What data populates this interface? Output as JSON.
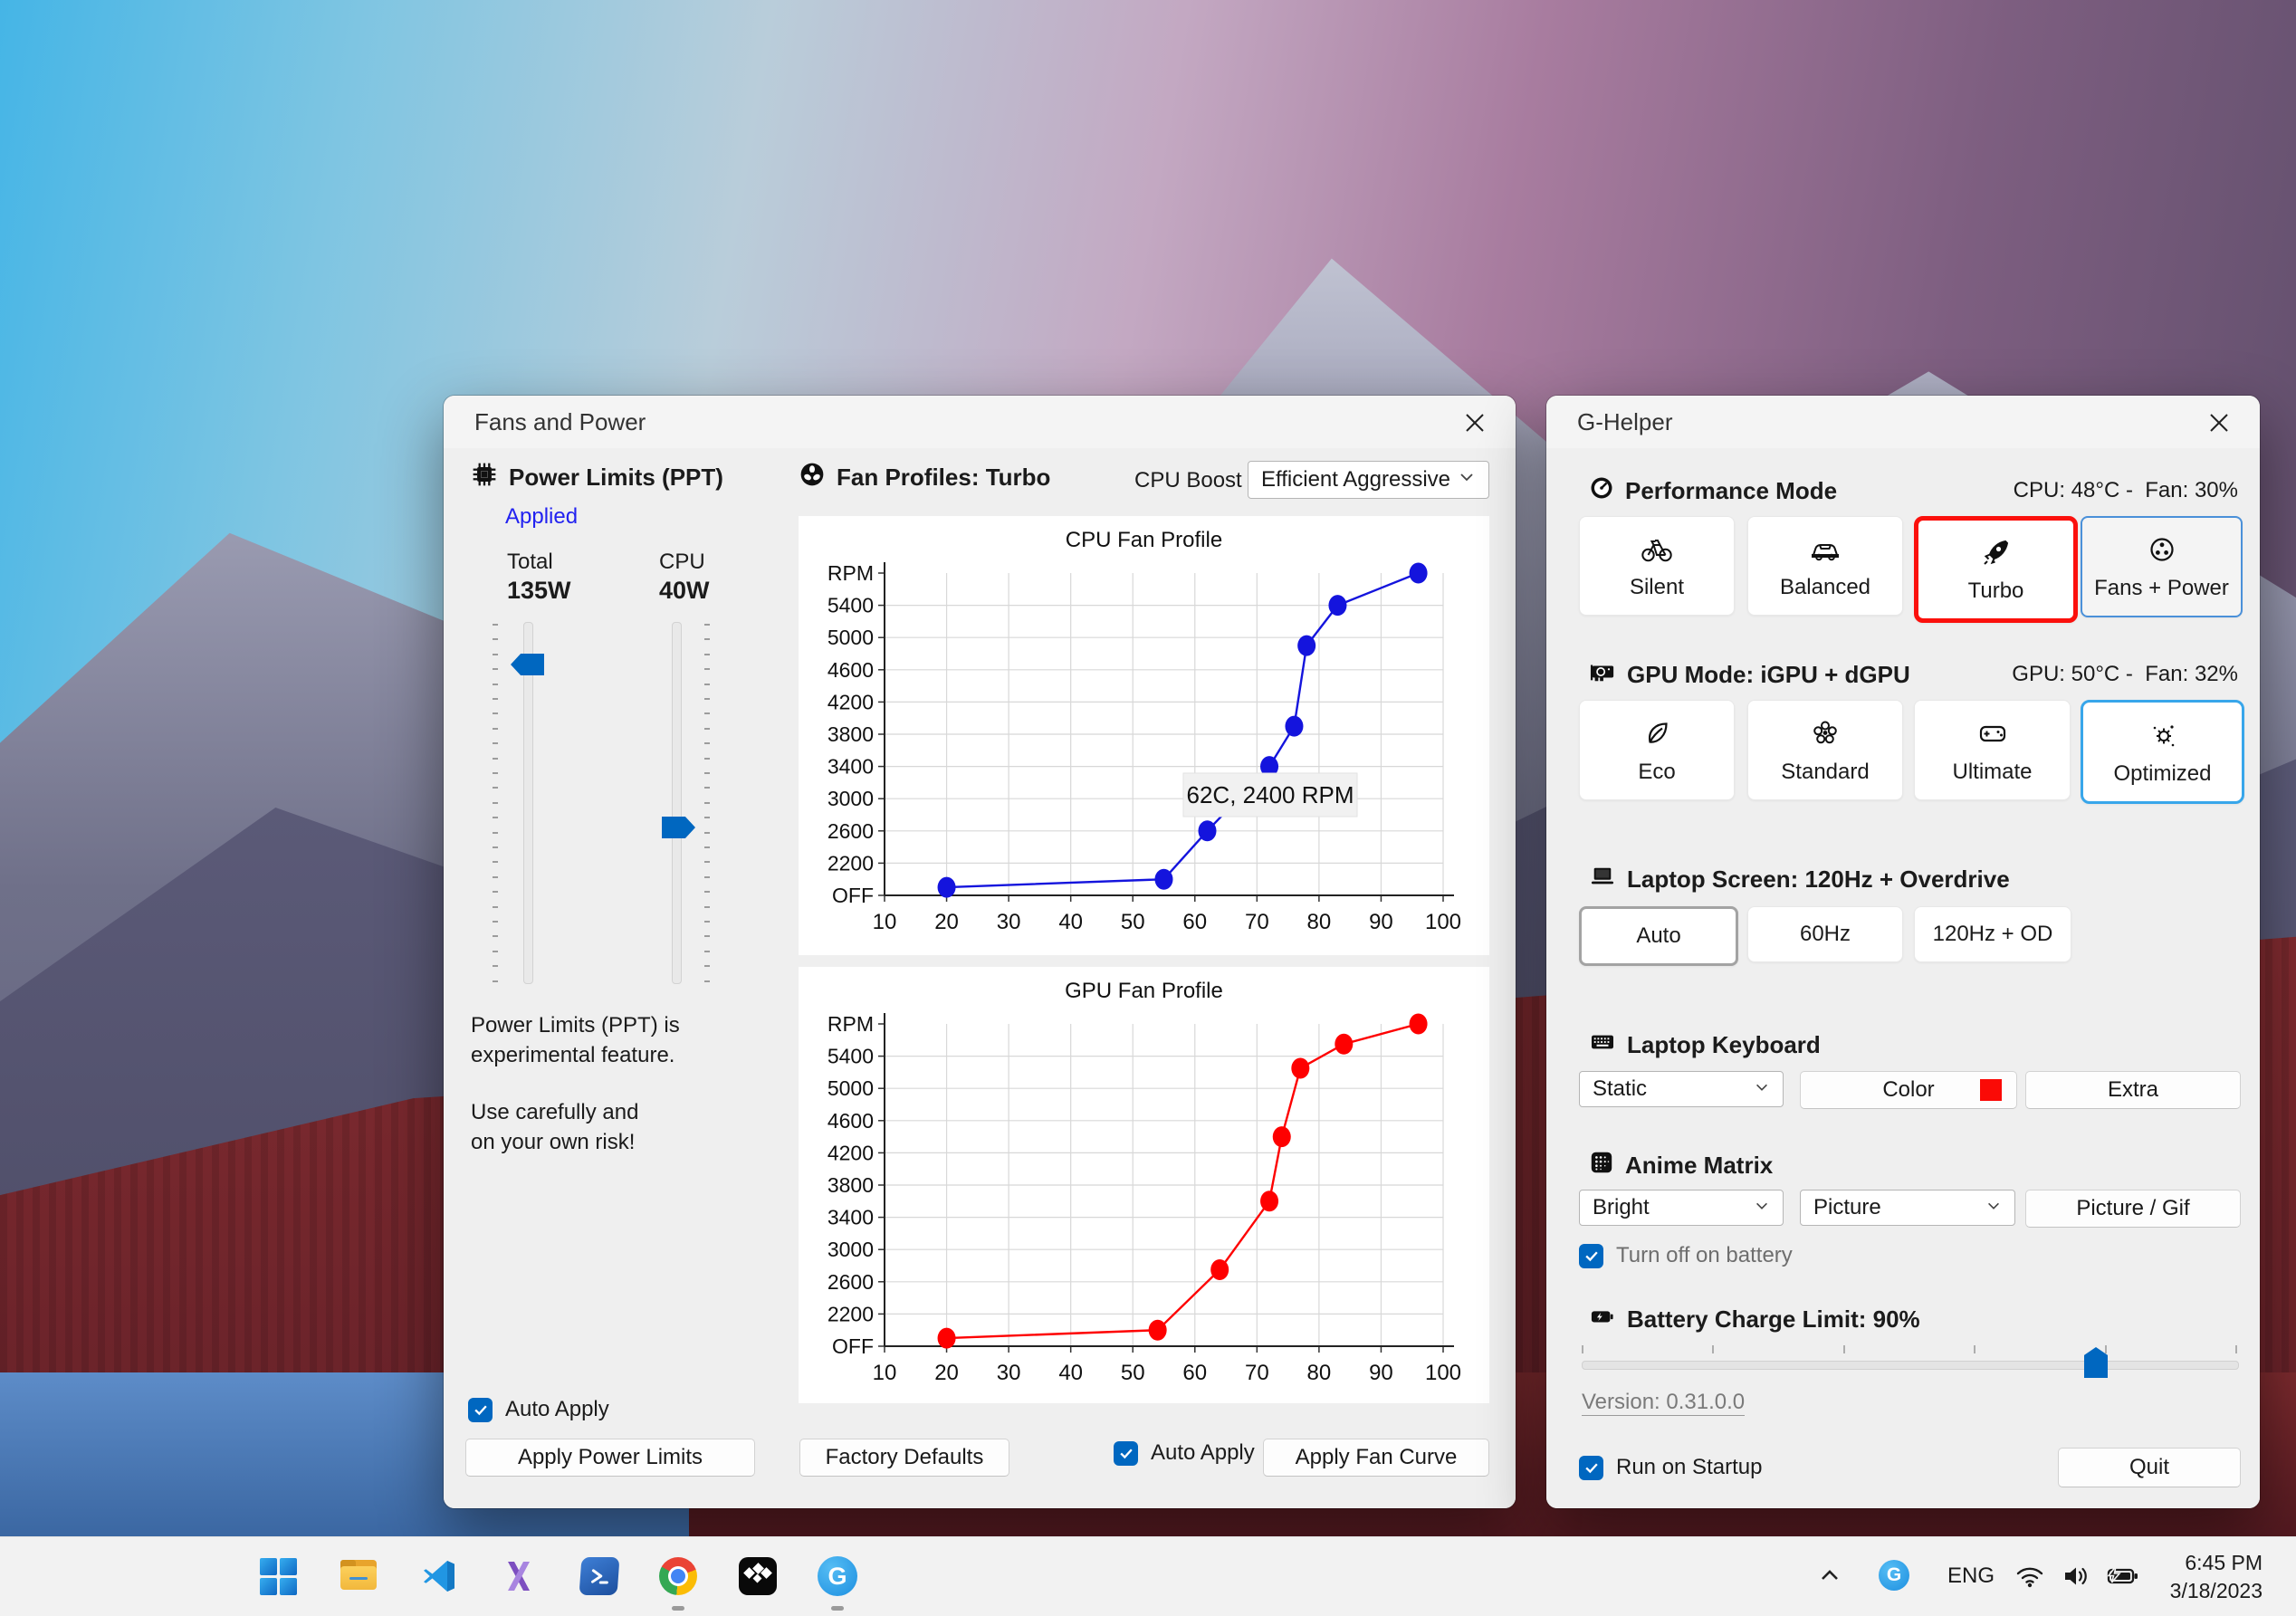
{
  "colors": {
    "accent_blue": "#0067c0",
    "selected_red": "#fb100c",
    "selected_blue": "#38a6ea",
    "keyboard_color_swatch": "#fa0a06",
    "chart_cpu_blue": "#1414dd",
    "chart_gpu_red": "#fe0000"
  },
  "fans_window": {
    "title": "Fans and Power",
    "power_limits": {
      "header": "Power Limits (PPT)",
      "applied": "Applied",
      "total_label": "Total",
      "total_value": "135W",
      "cpu_label": "CPU",
      "cpu_value": "40W",
      "warning_line1": "Power Limits (PPT) is",
      "warning_line2": "experimental feature.",
      "warning_line3": "Use carefully and",
      "warning_line4": "on your own risk!",
      "auto_apply_label": "Auto Apply",
      "apply_button": "Apply Power Limits"
    },
    "fan_profiles": {
      "header": "Fan Profiles: Turbo",
      "cpu_boost_label": "CPU Boost",
      "cpu_boost_value": "Efficient Aggressive",
      "factory_defaults_button": "Factory Defaults",
      "auto_apply_label": "Auto Apply",
      "apply_button": "Apply Fan Curve"
    }
  },
  "chart_data": [
    {
      "id": "cpu-fan-profile",
      "type": "line",
      "title": "CPU Fan Profile",
      "color": "#1414dd",
      "xlim": [
        10,
        100
      ],
      "ylim_rpm": [
        1800,
        5800
      ],
      "x_ticks": [
        10,
        20,
        30,
        40,
        50,
        60,
        70,
        80,
        90,
        100
      ],
      "y_tick_labels": [
        "RPM",
        "5400",
        "5000",
        "4600",
        "4200",
        "3800",
        "3400",
        "3000",
        "2600",
        "2200",
        "OFF"
      ],
      "grid": true,
      "points": [
        {
          "x": 20,
          "rpm": 1900
        },
        {
          "x": 55,
          "rpm": 2000
        },
        {
          "x": 62,
          "rpm": 2600
        },
        {
          "x": 72,
          "rpm": 3400
        },
        {
          "x": 76,
          "rpm": 3900
        },
        {
          "x": 78,
          "rpm": 4900
        },
        {
          "x": 83,
          "rpm": 5400
        },
        {
          "x": 96,
          "rpm": 5800
        }
      ],
      "tooltip": {
        "text": "62C, 2400 RPM"
      }
    },
    {
      "id": "gpu-fan-profile",
      "type": "line",
      "title": "GPU Fan Profile",
      "color": "#fe0000",
      "xlim": [
        10,
        100
      ],
      "ylim_rpm": [
        1800,
        5800
      ],
      "x_ticks": [
        10,
        20,
        30,
        40,
        50,
        60,
        70,
        80,
        90,
        100
      ],
      "y_tick_labels": [
        "RPM",
        "5400",
        "5000",
        "4600",
        "4200",
        "3800",
        "3400",
        "3000",
        "2600",
        "2200",
        "OFF"
      ],
      "grid": true,
      "points": [
        {
          "x": 20,
          "rpm": 1900
        },
        {
          "x": 54,
          "rpm": 2000
        },
        {
          "x": 64,
          "rpm": 2750
        },
        {
          "x": 72,
          "rpm": 3600
        },
        {
          "x": 74,
          "rpm": 4400
        },
        {
          "x": 77,
          "rpm": 5250
        },
        {
          "x": 84,
          "rpm": 5550
        },
        {
          "x": 96,
          "rpm": 5800
        }
      ]
    }
  ],
  "ghelper": {
    "title": "G-Helper",
    "performance": {
      "header": "Performance Mode",
      "status": "CPU: 48°C -  Fan: 30%",
      "buttons": [
        {
          "label": "Silent"
        },
        {
          "label": "Balanced"
        },
        {
          "label": "Turbo"
        },
        {
          "label": "Fans + Power"
        }
      ]
    },
    "gpu": {
      "header": "GPU Mode: iGPU + dGPU",
      "status": "GPU: 50°C -  Fan: 32%",
      "buttons": [
        {
          "label": "Eco"
        },
        {
          "label": "Standard"
        },
        {
          "label": "Ultimate"
        },
        {
          "label": "Optimized"
        }
      ]
    },
    "screen": {
      "header": "Laptop Screen: 120Hz + Overdrive",
      "buttons": [
        {
          "label": "Auto"
        },
        {
          "label": "60Hz"
        },
        {
          "label": "120Hz + OD"
        }
      ]
    },
    "keyboard": {
      "header": "Laptop Keyboard",
      "mode_value": "Static",
      "color_button": "Color",
      "extra_button": "Extra"
    },
    "matrix": {
      "header": "Anime Matrix",
      "brightness_value": "Bright",
      "mode_value": "Picture",
      "picture_gif_button": "Picture / Gif",
      "turn_off_label": "Turn off on battery"
    },
    "battery": {
      "header": "Battery Charge Limit: 90%"
    },
    "version_link": "Version: 0.31.0.0",
    "run_on_startup_label": "Run on Startup",
    "quit_button": "Quit"
  },
  "taskbar": {
    "ghelper_glyph": "G",
    "tray": {
      "language": "ENG",
      "time": "6:45 PM",
      "date": "3/18/2023"
    }
  }
}
